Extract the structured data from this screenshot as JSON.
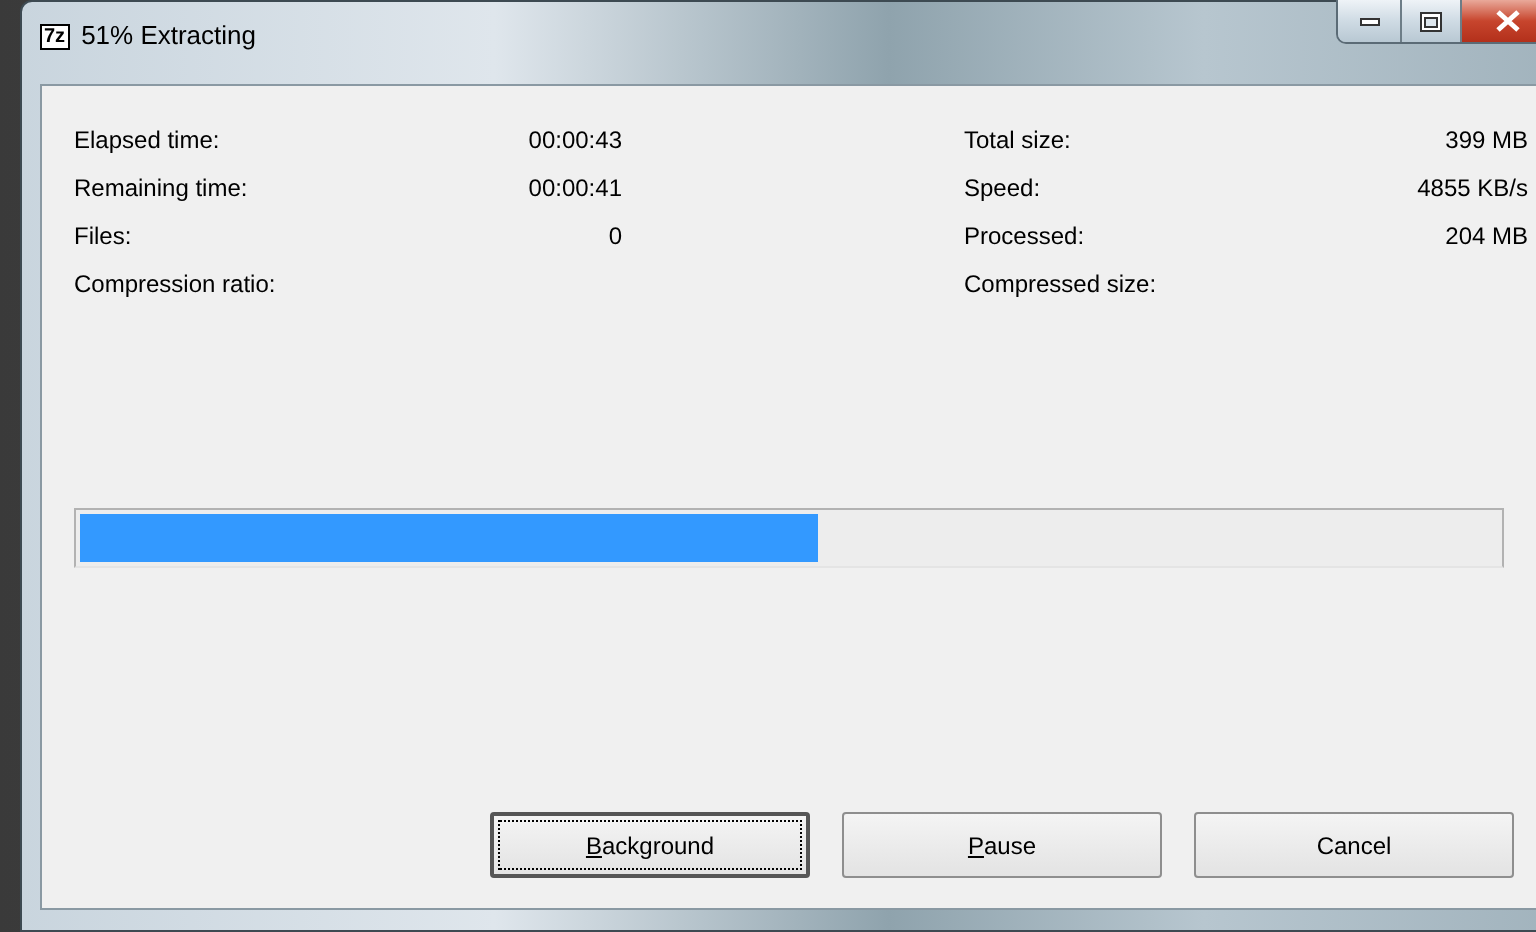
{
  "window": {
    "icon_text": "7z",
    "title": "51% Extracting"
  },
  "stats_left": [
    {
      "label": "Elapsed time:",
      "value": "00:00:43"
    },
    {
      "label": "Remaining time:",
      "value": "00:00:41"
    },
    {
      "label": "Files:",
      "value": "0"
    },
    {
      "label": "Compression ratio:"
    }
  ],
  "stats_right": [
    {
      "label": "Total size:",
      "value": "399 MB"
    },
    {
      "label": "Speed:",
      "value": "4855 KB/s"
    },
    {
      "label": "Processed:",
      "value": "204 MB"
    },
    {
      "label": "Compressed size:"
    }
  ],
  "progress": {
    "level": 0.52
  },
  "buttons": [
    {
      "label": "Background",
      "focused": true,
      "access_key_underlined": true
    },
    {
      "label": "Pause",
      "focused": false,
      "access_key_underlined": true
    },
    {
      "label": "Cancel",
      "focused": false,
      "access_key_underlined": false
    }
  ]
}
